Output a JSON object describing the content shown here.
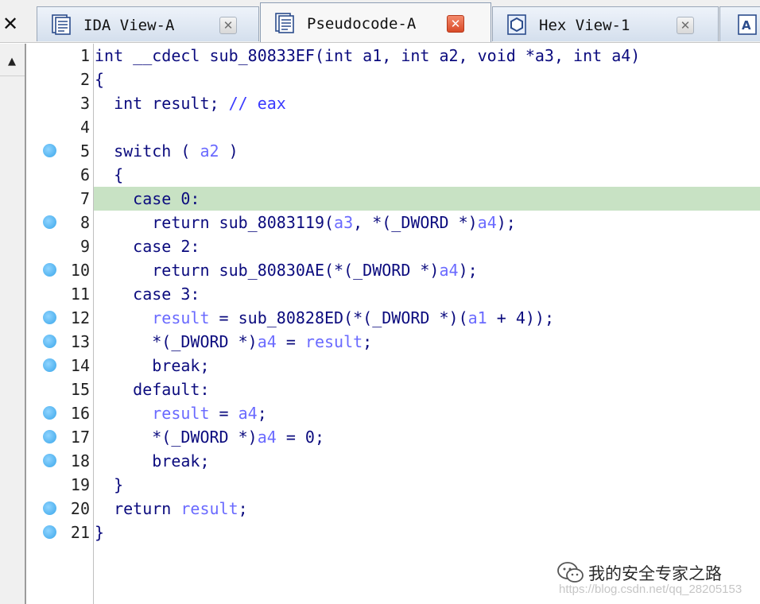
{
  "tabbar": {
    "left_close_glyph": "✕",
    "tabs": [
      {
        "label": "IDA View-A",
        "icon": "ida-view-icon",
        "close_glyph": "✕",
        "active": false
      },
      {
        "label": "Pseudocode-A",
        "icon": "pseudocode-icon",
        "close_glyph": "✕",
        "active": true
      },
      {
        "label": "Hex View-1",
        "icon": "hex-view-icon",
        "close_glyph": "✕",
        "active": false
      },
      {
        "label": "",
        "icon": "structures-icon",
        "active": false
      }
    ]
  },
  "scrollbar": {
    "up_glyph": "▲"
  },
  "colors": {
    "keyword": "#0b0b7e",
    "variable": "#6a6aff",
    "comment": "#3a3aff",
    "highlight_line": "#c8e2c4",
    "breakpoint": "#3aa6ea",
    "active_tab_close": "#d84a28"
  },
  "highlighted_line": 7,
  "code": {
    "lines": [
      {
        "num": "1",
        "bp": false,
        "segs": [
          [
            "n",
            "int __cdecl sub_80833EF(int a1, int a2, void *a3, int a4)"
          ]
        ]
      },
      {
        "num": "2",
        "bp": false,
        "segs": [
          [
            "n",
            "{"
          ]
        ]
      },
      {
        "num": "3",
        "bp": false,
        "segs": [
          [
            "n",
            "  int result; "
          ],
          [
            "c",
            "// eax"
          ]
        ]
      },
      {
        "num": "4",
        "bp": false,
        "segs": []
      },
      {
        "num": "5",
        "bp": true,
        "segs": [
          [
            "n",
            "  switch ( "
          ],
          [
            "v",
            "a2"
          ],
          [
            "n",
            " )"
          ]
        ]
      },
      {
        "num": "6",
        "bp": false,
        "segs": [
          [
            "n",
            "  {"
          ]
        ]
      },
      {
        "num": "7",
        "bp": false,
        "segs": [
          [
            "n",
            "    case 0:"
          ]
        ]
      },
      {
        "num": "8",
        "bp": true,
        "segs": [
          [
            "n",
            "      return sub_8083119("
          ],
          [
            "v",
            "a3"
          ],
          [
            "n",
            ", *(_DWORD *)"
          ],
          [
            "v",
            "a4"
          ],
          [
            "n",
            ");"
          ]
        ]
      },
      {
        "num": "9",
        "bp": false,
        "segs": [
          [
            "n",
            "    case 2:"
          ]
        ]
      },
      {
        "num": "10",
        "bp": true,
        "segs": [
          [
            "n",
            "      return sub_80830AE(*(_DWORD *)"
          ],
          [
            "v",
            "a4"
          ],
          [
            "n",
            ");"
          ]
        ]
      },
      {
        "num": "11",
        "bp": false,
        "segs": [
          [
            "n",
            "    case 3:"
          ]
        ]
      },
      {
        "num": "12",
        "bp": true,
        "segs": [
          [
            "n",
            "      "
          ],
          [
            "v",
            "result"
          ],
          [
            "n",
            " = sub_80828ED(*(_DWORD *)("
          ],
          [
            "v",
            "a1"
          ],
          [
            "n",
            " + 4));"
          ]
        ]
      },
      {
        "num": "13",
        "bp": true,
        "segs": [
          [
            "n",
            "      *(_DWORD *)"
          ],
          [
            "v",
            "a4"
          ],
          [
            "n",
            " = "
          ],
          [
            "v",
            "result"
          ],
          [
            "n",
            ";"
          ]
        ]
      },
      {
        "num": "14",
        "bp": true,
        "segs": [
          [
            "n",
            "      break;"
          ]
        ]
      },
      {
        "num": "15",
        "bp": false,
        "segs": [
          [
            "n",
            "    default:"
          ]
        ]
      },
      {
        "num": "16",
        "bp": true,
        "segs": [
          [
            "n",
            "      "
          ],
          [
            "v",
            "result"
          ],
          [
            "n",
            " = "
          ],
          [
            "v",
            "a4"
          ],
          [
            "n",
            ";"
          ]
        ]
      },
      {
        "num": "17",
        "bp": true,
        "segs": [
          [
            "n",
            "      *(_DWORD *)"
          ],
          [
            "v",
            "a4"
          ],
          [
            "n",
            " = 0;"
          ]
        ]
      },
      {
        "num": "18",
        "bp": true,
        "segs": [
          [
            "n",
            "      break;"
          ]
        ]
      },
      {
        "num": "19",
        "bp": false,
        "segs": [
          [
            "n",
            "  }"
          ]
        ]
      },
      {
        "num": "20",
        "bp": true,
        "segs": [
          [
            "n",
            "  return "
          ],
          [
            "v",
            "result"
          ],
          [
            "n",
            ";"
          ]
        ]
      },
      {
        "num": "21",
        "bp": true,
        "segs": [
          [
            "n",
            "}"
          ]
        ]
      }
    ]
  },
  "watermark": {
    "icon": "wechat-icon",
    "title": "我的安全专家之路",
    "url": "https://blog.csdn.net/qq_28205153"
  }
}
